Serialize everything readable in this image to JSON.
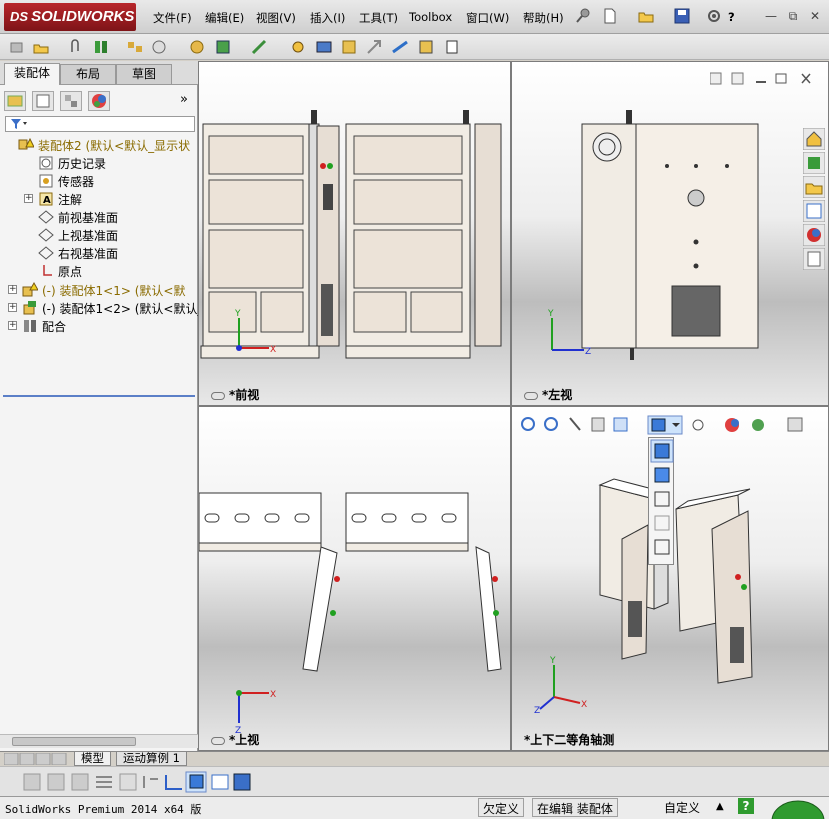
{
  "app": {
    "brand_prefix": "DS",
    "brand": "SOLIDWORKS"
  },
  "menu": {
    "items": [
      "文件(F)",
      "编辑(E)",
      "视图(V)",
      "插入(I)",
      "工具(T)",
      "Toolbox",
      "窗口(W)",
      "帮助(H)"
    ],
    "help_symbol": "?"
  },
  "window_controls": {
    "minimize": "—",
    "restore": "⧉",
    "close": "✕"
  },
  "left_panel": {
    "tabs": [
      "装配体",
      "布局",
      "草图"
    ],
    "expand_glyph": "»",
    "tree": [
      {
        "label": "装配体2  (默认<默认_显示状",
        "icon": "assembly-warning-icon",
        "expandable": false,
        "warning": true
      },
      {
        "label": "历史记录",
        "icon": "history-icon",
        "expandable": false,
        "warning": false
      },
      {
        "label": "传感器",
        "icon": "sensor-icon",
        "expandable": false,
        "warning": false
      },
      {
        "label": "注解",
        "icon": "annotation-icon",
        "expandable": true,
        "warning": false
      },
      {
        "label": "前视基准面",
        "icon": "plane-icon",
        "expandable": false,
        "warning": false
      },
      {
        "label": "上视基准面",
        "icon": "plane-icon",
        "expandable": false,
        "warning": false
      },
      {
        "label": "右视基准面",
        "icon": "plane-icon",
        "expandable": false,
        "warning": false
      },
      {
        "label": "原点",
        "icon": "origin-icon",
        "expandable": false,
        "warning": false
      },
      {
        "label": "(-) 装配体1<1> (默认<默",
        "icon": "subassembly-warning-icon",
        "expandable": true,
        "warning": true
      },
      {
        "label": "(-) 装配体1<2> (默认<默认_",
        "icon": "subassembly-icon",
        "expandable": true,
        "warning": false
      },
      {
        "label": "配合",
        "icon": "mates-icon",
        "expandable": true,
        "warning": false
      }
    ]
  },
  "viewports": {
    "front": {
      "label": "*前视"
    },
    "left": {
      "label": "*左视"
    },
    "top": {
      "label": "*上视"
    },
    "iso": {
      "label": "*上下二等角轴测"
    }
  },
  "axes": {
    "x": "X",
    "y": "Y",
    "z": "Z"
  },
  "bottom_tabs": [
    "模型",
    "运动算例 1"
  ],
  "status": {
    "product": "SolidWorks Premium 2014 x64 版",
    "state_under": "欠定义",
    "state_editing": "在编辑 装配体",
    "units": "自定义",
    "help": "?"
  },
  "colors": {
    "brand_red": "#b8262b",
    "cabinet_face": "#f1ece4",
    "axis_x": "#d02020",
    "axis_y": "#20a020",
    "axis_z": "#2030d0"
  }
}
